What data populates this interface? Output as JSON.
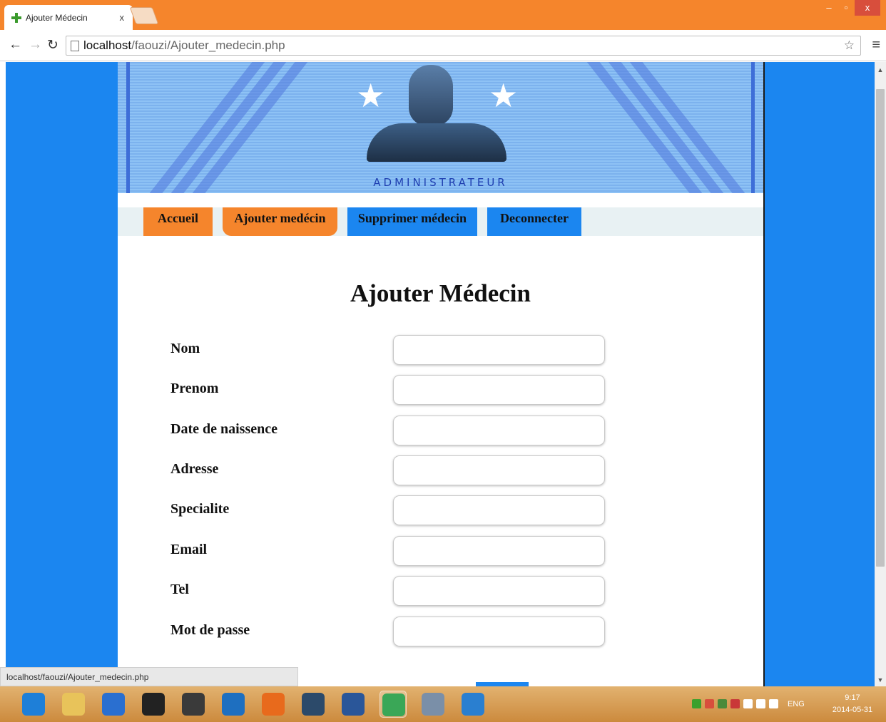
{
  "browser": {
    "tab_title": "Ajouter Médecin",
    "tab_close": "x",
    "url_host": "localhost",
    "url_path": "/faouzi/Ajouter_medecin.php",
    "window_minimize": "–",
    "window_restore": "▫",
    "window_close": "x",
    "status_text": "localhost/faouzi/Ajouter_medecin.php"
  },
  "icons": {
    "back": "back-arrow-icon",
    "forward": "forward-arrow-icon",
    "reload": "reload-icon",
    "star": "bookmark-star-icon",
    "menu": "menu-icon"
  },
  "banner": {
    "label": "ADMINISTRATEUR"
  },
  "nav": {
    "items": [
      {
        "label": "Accueil",
        "color": "#f5852c"
      },
      {
        "label": "Ajouter medécin",
        "color": "#f5852c"
      },
      {
        "label": "Supprimer médecin",
        "color": "#1b86f0"
      },
      {
        "label": "Deconnecter",
        "color": "#1b86f0"
      }
    ]
  },
  "form": {
    "title": "Ajouter Médecin",
    "fields": [
      {
        "label": "Nom",
        "value": ""
      },
      {
        "label": "Prenom",
        "value": ""
      },
      {
        "label": "Date de naissence",
        "value": ""
      },
      {
        "label": "Adresse",
        "value": ""
      },
      {
        "label": "Specialite",
        "value": ""
      },
      {
        "label": "Email",
        "value": ""
      },
      {
        "label": "Tel",
        "value": ""
      },
      {
        "label": "Mot de passe",
        "value": ""
      }
    ]
  },
  "taskbar": {
    "apps": [
      {
        "name": "internet-explorer-icon",
        "color": "#1e7fd8"
      },
      {
        "name": "file-explorer-icon",
        "color": "#e8c35a"
      },
      {
        "name": "tool-icon",
        "color": "#2a6fd0"
      },
      {
        "name": "media-player-icon",
        "color": "#222222"
      },
      {
        "name": "app-puzzle-icon",
        "color": "#3a3a3a"
      },
      {
        "name": "hp-icon",
        "color": "#1e6fc0"
      },
      {
        "name": "firefox-icon",
        "color": "#e86a1c"
      },
      {
        "name": "mysql-workbench-icon",
        "color": "#2c4a6a"
      },
      {
        "name": "word-icon",
        "color": "#2a5699"
      },
      {
        "name": "chrome-icon",
        "color": "#3aa757"
      },
      {
        "name": "paint-icon",
        "color": "#7a8fa8"
      },
      {
        "name": "app-blue-icon",
        "color": "#2a7fd0"
      }
    ],
    "active_index": 9,
    "tray_lang": "ENG",
    "time": "9:17",
    "date": "2014-05-31"
  }
}
